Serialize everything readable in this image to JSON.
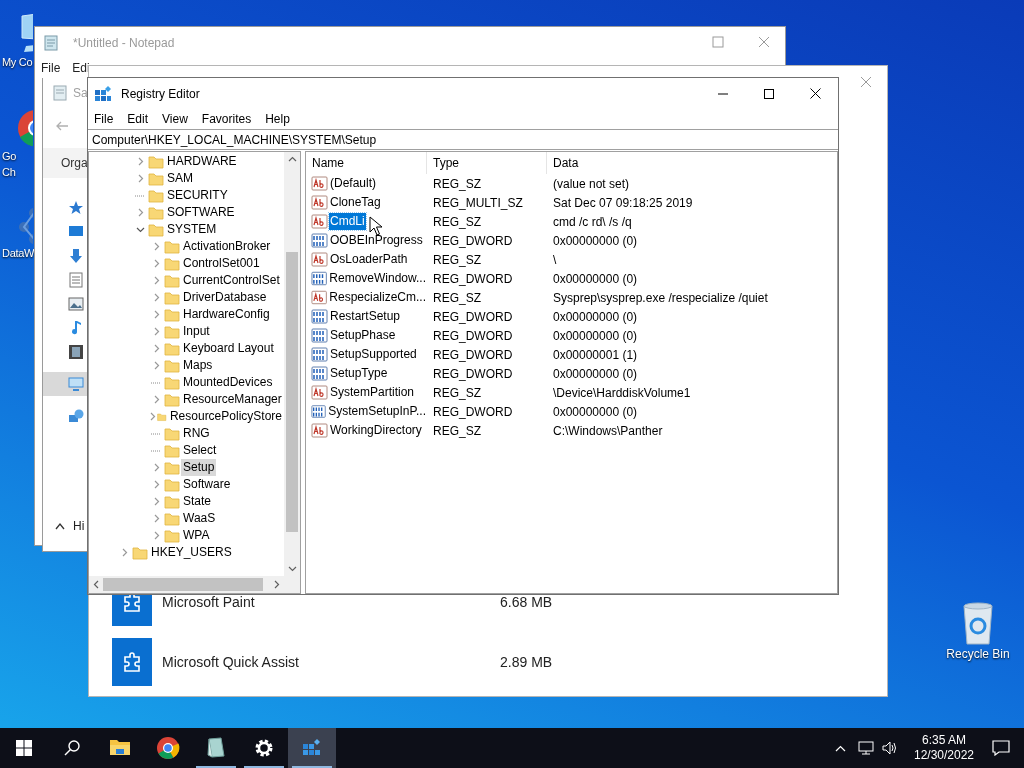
{
  "desktop": {
    "icons": [
      {
        "kind": "computer",
        "lines": [
          "My Co"
        ]
      },
      {
        "kind": "chrome",
        "lines": [
          "Go",
          "Ch"
        ]
      },
      {
        "kind": "molecule-app",
        "lines": [
          "DataW"
        ]
      },
      {
        "kind": "recycle",
        "lines": [
          "Recycle Bin"
        ]
      }
    ]
  },
  "notepad": {
    "title": "*Untitled - Notepad",
    "menu": [
      "File",
      "Edi"
    ]
  },
  "save_dialog": {
    "title": "Sa",
    "toolbar": "Orga",
    "hide_folders": "Hi",
    "nav": [
      {
        "kind": "star",
        "selected": false
      },
      {
        "kind": "desktop",
        "selected": false
      },
      {
        "kind": "download",
        "selected": false
      },
      {
        "kind": "document",
        "selected": false
      },
      {
        "kind": "pictures",
        "selected": false
      },
      {
        "kind": "music",
        "selected": false
      },
      {
        "kind": "video",
        "selected": false
      },
      {
        "kind": "pc",
        "selected": true
      },
      {
        "kind": "network",
        "selected": false
      }
    ]
  },
  "settings": {
    "apps": [
      {
        "name": "Microsoft Paint",
        "size": "6.68 MB"
      },
      {
        "name": "Microsoft Quick Assist",
        "size": "2.89 MB"
      }
    ]
  },
  "regedit": {
    "title": "Registry Editor",
    "menu": [
      "File",
      "Edit",
      "View",
      "Favorites",
      "Help"
    ],
    "address": "Computer\\HKEY_LOCAL_MACHINE\\SYSTEM\\Setup",
    "tree": {
      "items": [
        {
          "label": "HARDWARE",
          "has_children": true,
          "expanded": false,
          "selected": false
        },
        {
          "label": "SAM",
          "has_children": true,
          "expanded": false,
          "selected": false
        },
        {
          "label": "SECURITY",
          "has_children": false,
          "selected": false
        },
        {
          "label": "SOFTWARE",
          "has_children": true,
          "expanded": false,
          "selected": false
        },
        {
          "label": "SYSTEM",
          "has_children": true,
          "expanded": true,
          "selected": false,
          "children": [
            {
              "label": "ActivationBroker",
              "has_children": true,
              "expanded": false,
              "selected": false
            },
            {
              "label": "ControlSet001",
              "has_children": true,
              "expanded": false,
              "selected": false
            },
            {
              "label": "CurrentControlSet",
              "has_children": true,
              "expanded": false,
              "selected": false
            },
            {
              "label": "DriverDatabase",
              "has_children": true,
              "expanded": false,
              "selected": false
            },
            {
              "label": "HardwareConfig",
              "has_children": true,
              "expanded": false,
              "selected": false
            },
            {
              "label": "Input",
              "has_children": true,
              "expanded": false,
              "selected": false
            },
            {
              "label": "Keyboard Layout",
              "has_children": true,
              "expanded": false,
              "selected": false
            },
            {
              "label": "Maps",
              "has_children": true,
              "expanded": false,
              "selected": false
            },
            {
              "label": "MountedDevices",
              "has_children": false,
              "selected": false
            },
            {
              "label": "ResourceManager",
              "has_children": true,
              "expanded": false,
              "selected": false
            },
            {
              "label": "ResourcePolicyStore",
              "has_children": true,
              "expanded": false,
              "selected": false
            },
            {
              "label": "RNG",
              "has_children": false,
              "selected": false
            },
            {
              "label": "Select",
              "has_children": false,
              "selected": false
            },
            {
              "label": "Setup",
              "has_children": true,
              "expanded": false,
              "selected": true
            },
            {
              "label": "Software",
              "has_children": true,
              "expanded": false,
              "selected": false
            },
            {
              "label": "State",
              "has_children": true,
              "expanded": false,
              "selected": false
            },
            {
              "label": "WaaS",
              "has_children": true,
              "expanded": false,
              "selected": false
            },
            {
              "label": "WPA",
              "has_children": true,
              "expanded": false,
              "selected": false
            }
          ]
        }
      ],
      "root_items": [
        {
          "label": "HKEY_USERS",
          "has_children": true,
          "expanded": false,
          "selected": false
        }
      ]
    },
    "columns": [
      "Name",
      "Type",
      "Data"
    ],
    "rows": [
      {
        "kind": "sz",
        "name": "(Default)",
        "type": "REG_SZ",
        "data": "(value not set)",
        "selected": false
      },
      {
        "kind": "sz",
        "name": "CloneTag",
        "type": "REG_MULTI_SZ",
        "data": "Sat Dec 07 09:18:25 2019",
        "selected": false
      },
      {
        "kind": "sz",
        "name": "CmdLi",
        "type": "REG_SZ",
        "data": "cmd /c rd\\ /s /q",
        "selected": true
      },
      {
        "kind": "dword",
        "name": "OOBEInProgress",
        "type": "REG_DWORD",
        "data": "0x00000000 (0)",
        "selected": false
      },
      {
        "kind": "sz",
        "name": "OsLoaderPath",
        "type": "REG_SZ",
        "data": "\\",
        "selected": false
      },
      {
        "kind": "dword",
        "name": "RemoveWindow...",
        "type": "REG_DWORD",
        "data": "0x00000000 (0)",
        "selected": false
      },
      {
        "kind": "sz",
        "name": "RespecializeCm...",
        "type": "REG_SZ",
        "data": "Sysprep\\sysprep.exe /respecialize /quiet",
        "selected": false
      },
      {
        "kind": "dword",
        "name": "RestartSetup",
        "type": "REG_DWORD",
        "data": "0x00000000 (0)",
        "selected": false
      },
      {
        "kind": "dword",
        "name": "SetupPhase",
        "type": "REG_DWORD",
        "data": "0x00000000 (0)",
        "selected": false
      },
      {
        "kind": "dword",
        "name": "SetupSupported",
        "type": "REG_DWORD",
        "data": "0x00000001 (1)",
        "selected": false
      },
      {
        "kind": "dword",
        "name": "SetupType",
        "type": "REG_DWORD",
        "data": "0x00000000 (0)",
        "selected": false
      },
      {
        "kind": "sz",
        "name": "SystemPartition",
        "type": "REG_SZ",
        "data": "\\Device\\HarddiskVolume1",
        "selected": false
      },
      {
        "kind": "dword",
        "name": "SystemSetupInP...",
        "type": "REG_DWORD",
        "data": "0x00000000 (0)",
        "selected": false
      },
      {
        "kind": "sz",
        "name": "WorkingDirectory",
        "type": "REG_SZ",
        "data": "C:\\Windows\\Panther",
        "selected": false
      }
    ]
  },
  "taskbar": {
    "apps": [
      {
        "kind": "explorer",
        "running": false,
        "active": false
      },
      {
        "kind": "chrome",
        "running": false,
        "active": false
      },
      {
        "kind": "notepad",
        "running": true,
        "active": false
      },
      {
        "kind": "settings",
        "running": true,
        "active": false
      },
      {
        "kind": "regedit",
        "running": true,
        "active": true
      }
    ],
    "time": "6:35 AM",
    "date": "12/30/2022"
  }
}
